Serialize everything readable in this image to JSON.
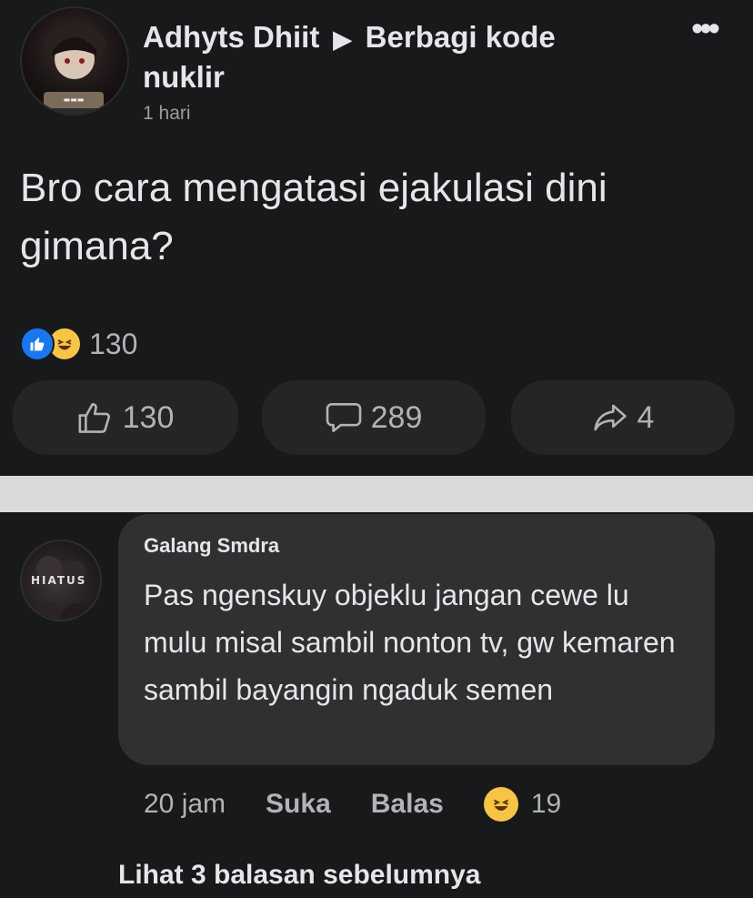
{
  "post": {
    "author": "Adhyts Dhiit",
    "arrow": "▶",
    "group_line1": "Berbagi kode",
    "group_line2": "nuklir",
    "time": "1 hari",
    "more": "•••",
    "text": "Bro cara mengatasi ejakulasi dini gimana?",
    "reaction_count": "130",
    "reactions": [
      "like",
      "haha"
    ],
    "like_count": "130",
    "comment_count": "289",
    "share_count": "4"
  },
  "comment": {
    "avatar_label": "HIATUS",
    "author": "Galang Smdra",
    "text": "Pas ngenskuy objeklu jangan cewe lu mulu misal sambil nonton tv, gw kemaren sambil bayangin ngaduk semen",
    "time": "20 jam",
    "like_label": "Suka",
    "reply_label": "Balas",
    "reaction_count": "19"
  },
  "view_replies": "Lihat 3 balasan sebelumnya",
  "colors": {
    "background": "#18191a",
    "separator": "#d9dadb",
    "bubble": "#2f3031",
    "like_blue": "#1877f2",
    "haha_yellow": "#f7c543"
  }
}
